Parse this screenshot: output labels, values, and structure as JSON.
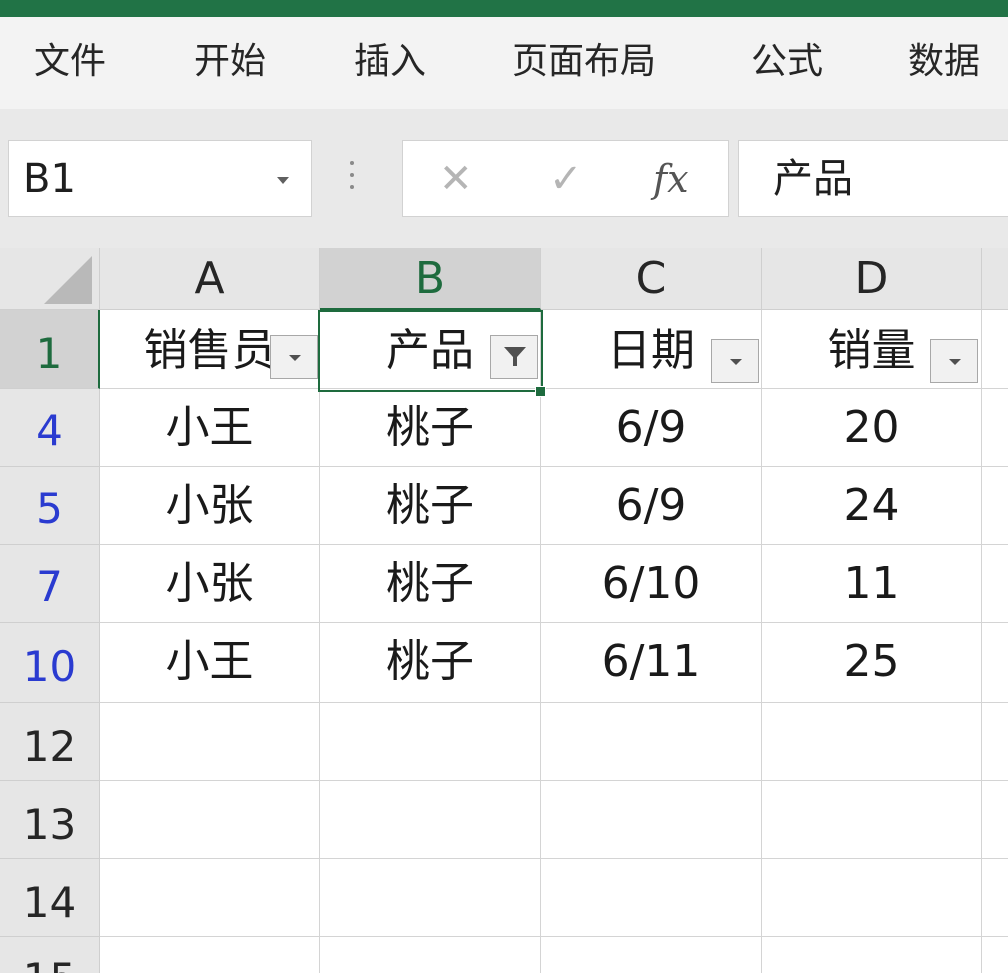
{
  "ribbon": {
    "tabs": [
      "文件",
      "开始",
      "插入",
      "页面布局",
      "公式",
      "数据"
    ]
  },
  "formula_bar": {
    "name_box": "B1",
    "cancel_icon": "✕",
    "enter_icon": "✓",
    "fx_label": "fx",
    "content": "产品"
  },
  "sheet": {
    "columns": [
      "A",
      "B",
      "C",
      "D"
    ],
    "selected_column": "B",
    "selected_row": "1",
    "row_headers": [
      "1",
      "4",
      "5",
      "7",
      "10",
      "12",
      "13",
      "14",
      "15"
    ],
    "header_row": [
      "销售员",
      "产品",
      "日期",
      "销量"
    ],
    "filter_active_column": "B",
    "rows": [
      [
        "小王",
        "桃子",
        "6/9",
        "20"
      ],
      [
        "小张",
        "桃子",
        "6/9",
        "24"
      ],
      [
        "小张",
        "桃子",
        "6/10",
        "11"
      ],
      [
        "小王",
        "桃子",
        "6/11",
        "25"
      ]
    ]
  },
  "colors": {
    "accent": "#217346",
    "selection": "#1e6b3e",
    "filtered_row_number": "#2a3bd0"
  }
}
